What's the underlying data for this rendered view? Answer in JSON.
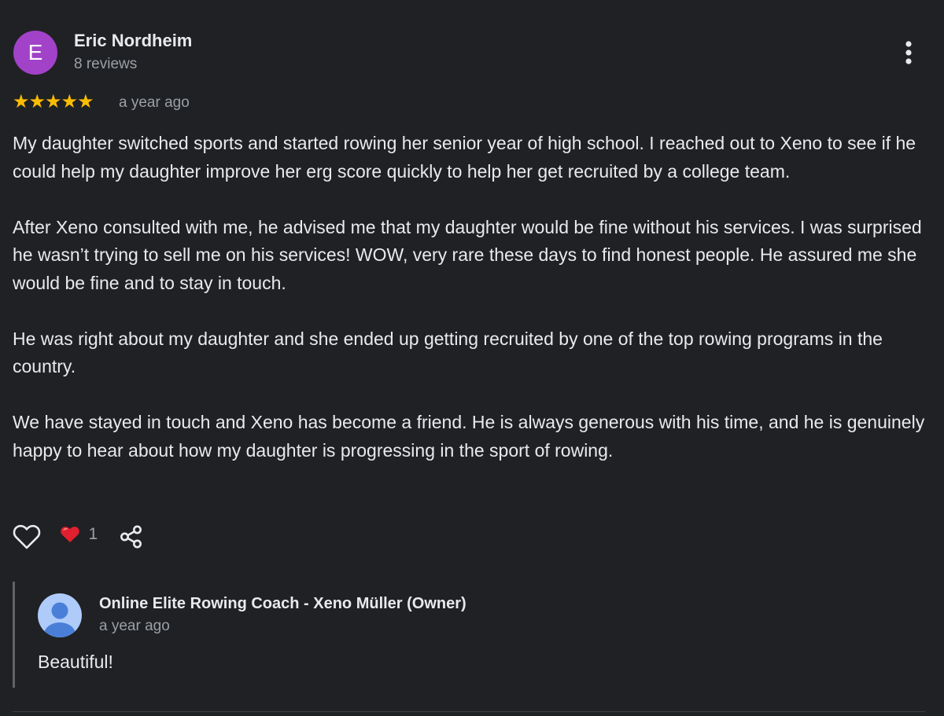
{
  "review": {
    "author": {
      "initial": "E",
      "name": "Eric Nordheim",
      "meta": "8 reviews",
      "avatar_color": "#a142c8"
    },
    "more_icon": "more-vert-icon",
    "rating": {
      "stars": "★★★★★",
      "value": 5,
      "max": 5,
      "time": "a year ago",
      "star_color": "#fbbc04"
    },
    "body": {
      "paragraphs": [
        "My daughter switched sports and started rowing her senior year of high school. I reached out to Xeno to see if he could help my daughter improve her erg score quickly to help her get recruited by a college team.",
        "After Xeno consulted with me, he advised me that my daughter would be fine without his services. I was surprised he wasn’t trying to sell me on his services! WOW, very rare these days to find honest people. He assured me she would be fine and to stay in touch.",
        "He was right about my daughter and she ended up getting recruited by one of the top rowing programs in the country.",
        "We have stayed in touch and Xeno has become a friend. He is always generous with his time, and he is genuinely happy to hear about how my daughter is progressing in the sport of rowing."
      ]
    },
    "actions": {
      "like_icon": "heart-outline-icon",
      "reaction_icon": "red-heart-emoji-icon",
      "reaction_count": "1",
      "share_icon": "share-icon"
    }
  },
  "owner_reply": {
    "name": "Online Elite Rowing Coach - Xeno Müller (Owner)",
    "time": "a year ago",
    "text": "Beautiful!",
    "avatar_icon": "default-profile-avatar-icon"
  },
  "colors": {
    "background": "#202124",
    "primary_text": "#e8eaed",
    "secondary_text": "#9aa0a6"
  }
}
